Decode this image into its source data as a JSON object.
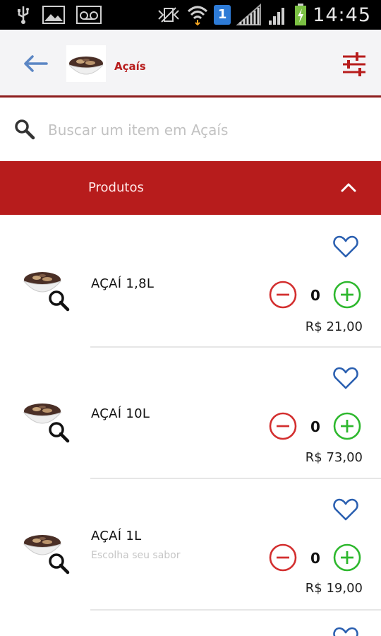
{
  "status_bar": {
    "time": "14:45",
    "notification_count": "1"
  },
  "header": {
    "title": "Açaís"
  },
  "search": {
    "placeholder": "Buscar um item em Açaís"
  },
  "section": {
    "title": "Produtos"
  },
  "products": [
    {
      "name": "AÇAÍ 1,8L",
      "description": "",
      "quantity": "0",
      "price": "R$ 21,00"
    },
    {
      "name": "AÇAÍ 10L",
      "description": "",
      "quantity": "0",
      "price": "R$ 73,00"
    },
    {
      "name": "AÇAÍ 1L",
      "description": "Escolha seu sabor",
      "quantity": "0",
      "price": "R$ 19,00"
    }
  ],
  "colors": {
    "primary_red": "#b71c1c",
    "minus_red": "#d32f2f",
    "plus_green": "#2eb82e",
    "heart_blue": "#2a5fb0",
    "back_blue": "#5b86c4"
  },
  "icons": [
    "usb-icon",
    "image-icon",
    "voicemail-icon",
    "vibrate-icon",
    "wifi-icon",
    "signal-icon",
    "battery-icon",
    "back-arrow-icon",
    "filter-icon",
    "search-icon",
    "chevron-up-icon",
    "heart-icon",
    "zoom-icon",
    "minus-icon",
    "plus-icon"
  ]
}
